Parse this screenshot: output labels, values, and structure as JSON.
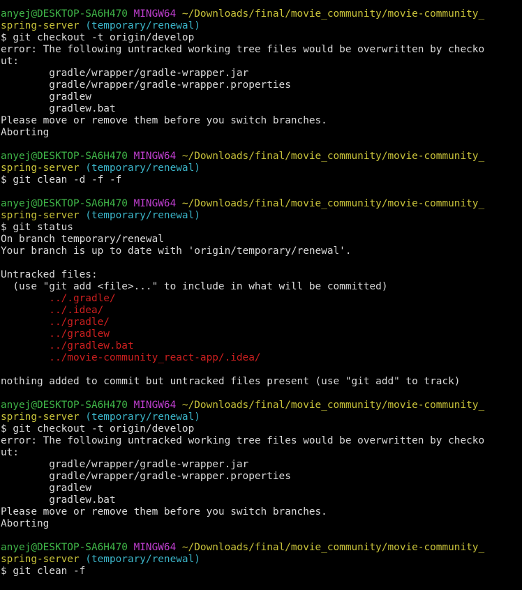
{
  "colors": {
    "background": "#000000",
    "text": "#d9d9d9",
    "user_host": "#3fb548",
    "mingw": "#c03fd0",
    "path": "#c8c23a",
    "branch": "#3bb4c8",
    "untracked": "#cc1f1f"
  },
  "lines": [
    {
      "segs": [
        {
          "t": "anyej@DESKTOP-SA6H470 ",
          "c": "user"
        },
        {
          "t": "MINGW64 ",
          "c": "host"
        },
        {
          "t": "~/Downloads/final/movie_community/movie-community_",
          "c": "path"
        }
      ]
    },
    {
      "segs": [
        {
          "t": "spring-server",
          "c": "path"
        },
        {
          "t": " (temporary/renewal)",
          "c": "branch"
        }
      ]
    },
    {
      "segs": [
        {
          "t": "$ git checkout -t origin/develop",
          "c": "white"
        }
      ]
    },
    {
      "segs": [
        {
          "t": "error: The following untracked working tree files would be overwritten by checko",
          "c": "white"
        }
      ]
    },
    {
      "segs": [
        {
          "t": "ut:",
          "c": "white"
        }
      ]
    },
    {
      "segs": [
        {
          "t": "        gradle/wrapper/gradle-wrapper.jar",
          "c": "white"
        }
      ]
    },
    {
      "segs": [
        {
          "t": "        gradle/wrapper/gradle-wrapper.properties",
          "c": "white"
        }
      ]
    },
    {
      "segs": [
        {
          "t": "        gradlew",
          "c": "white"
        }
      ]
    },
    {
      "segs": [
        {
          "t": "        gradlew.bat",
          "c": "white"
        }
      ]
    },
    {
      "segs": [
        {
          "t": "Please move or remove them before you switch branches.",
          "c": "white"
        }
      ]
    },
    {
      "segs": [
        {
          "t": "Aborting",
          "c": "white"
        }
      ]
    },
    {
      "segs": []
    },
    {
      "segs": [
        {
          "t": "anyej@DESKTOP-SA6H470 ",
          "c": "user"
        },
        {
          "t": "MINGW64 ",
          "c": "host"
        },
        {
          "t": "~/Downloads/final/movie_community/movie-community_",
          "c": "path"
        }
      ]
    },
    {
      "segs": [
        {
          "t": "spring-server",
          "c": "path"
        },
        {
          "t": " (temporary/renewal)",
          "c": "branch"
        }
      ]
    },
    {
      "segs": [
        {
          "t": "$ git clean -d -f -f",
          "c": "white"
        }
      ]
    },
    {
      "segs": []
    },
    {
      "segs": [
        {
          "t": "anyej@DESKTOP-SA6H470 ",
          "c": "user"
        },
        {
          "t": "MINGW64 ",
          "c": "host"
        },
        {
          "t": "~/Downloads/final/movie_community/movie-community_",
          "c": "path"
        }
      ]
    },
    {
      "segs": [
        {
          "t": "spring-server",
          "c": "path"
        },
        {
          "t": " (temporary/renewal)",
          "c": "branch"
        }
      ]
    },
    {
      "segs": [
        {
          "t": "$ git status",
          "c": "white"
        }
      ]
    },
    {
      "segs": [
        {
          "t": "On branch temporary/renewal",
          "c": "white"
        }
      ]
    },
    {
      "segs": [
        {
          "t": "Your branch is up to date with 'origin/temporary/renewal'.",
          "c": "white"
        }
      ]
    },
    {
      "segs": []
    },
    {
      "segs": [
        {
          "t": "Untracked files:",
          "c": "white"
        }
      ]
    },
    {
      "segs": [
        {
          "t": "  (use \"git add <file>...\" to include in what will be committed)",
          "c": "white"
        }
      ]
    },
    {
      "segs": [
        {
          "t": "        ../.gradle/",
          "c": "red"
        }
      ]
    },
    {
      "segs": [
        {
          "t": "        ../.idea/",
          "c": "red"
        }
      ]
    },
    {
      "segs": [
        {
          "t": "        ../gradle/",
          "c": "red"
        }
      ]
    },
    {
      "segs": [
        {
          "t": "        ../gradlew",
          "c": "red"
        }
      ]
    },
    {
      "segs": [
        {
          "t": "        ../gradlew.bat",
          "c": "red"
        }
      ]
    },
    {
      "segs": [
        {
          "t": "        ../movie-community_react-app/.idea/",
          "c": "red"
        }
      ]
    },
    {
      "segs": []
    },
    {
      "segs": [
        {
          "t": "nothing added to commit but untracked files present (use \"git add\" to track)",
          "c": "white"
        }
      ]
    },
    {
      "segs": []
    },
    {
      "segs": [
        {
          "t": "anyej@DESKTOP-SA6H470 ",
          "c": "user"
        },
        {
          "t": "MINGW64 ",
          "c": "host"
        },
        {
          "t": "~/Downloads/final/movie_community/movie-community_",
          "c": "path"
        }
      ]
    },
    {
      "segs": [
        {
          "t": "spring-server",
          "c": "path"
        },
        {
          "t": " (temporary/renewal)",
          "c": "branch"
        }
      ]
    },
    {
      "segs": [
        {
          "t": "$ git checkout -t origin/develop",
          "c": "white"
        }
      ]
    },
    {
      "segs": [
        {
          "t": "error: The following untracked working tree files would be overwritten by checko",
          "c": "white"
        }
      ]
    },
    {
      "segs": [
        {
          "t": "ut:",
          "c": "white"
        }
      ]
    },
    {
      "segs": [
        {
          "t": "        gradle/wrapper/gradle-wrapper.jar",
          "c": "white"
        }
      ]
    },
    {
      "segs": [
        {
          "t": "        gradle/wrapper/gradle-wrapper.properties",
          "c": "white"
        }
      ]
    },
    {
      "segs": [
        {
          "t": "        gradlew",
          "c": "white"
        }
      ]
    },
    {
      "segs": [
        {
          "t": "        gradlew.bat",
          "c": "white"
        }
      ]
    },
    {
      "segs": [
        {
          "t": "Please move or remove them before you switch branches.",
          "c": "white"
        }
      ]
    },
    {
      "segs": [
        {
          "t": "Aborting",
          "c": "white"
        }
      ]
    },
    {
      "segs": []
    },
    {
      "segs": [
        {
          "t": "anyej@DESKTOP-SA6H470 ",
          "c": "user"
        },
        {
          "t": "MINGW64 ",
          "c": "host"
        },
        {
          "t": "~/Downloads/final/movie_community/movie-community_",
          "c": "path"
        }
      ]
    },
    {
      "segs": [
        {
          "t": "spring-server",
          "c": "path"
        },
        {
          "t": " (temporary/renewal)",
          "c": "branch"
        }
      ]
    },
    {
      "segs": [
        {
          "t": "$ git clean -f",
          "c": "white"
        }
      ]
    }
  ]
}
